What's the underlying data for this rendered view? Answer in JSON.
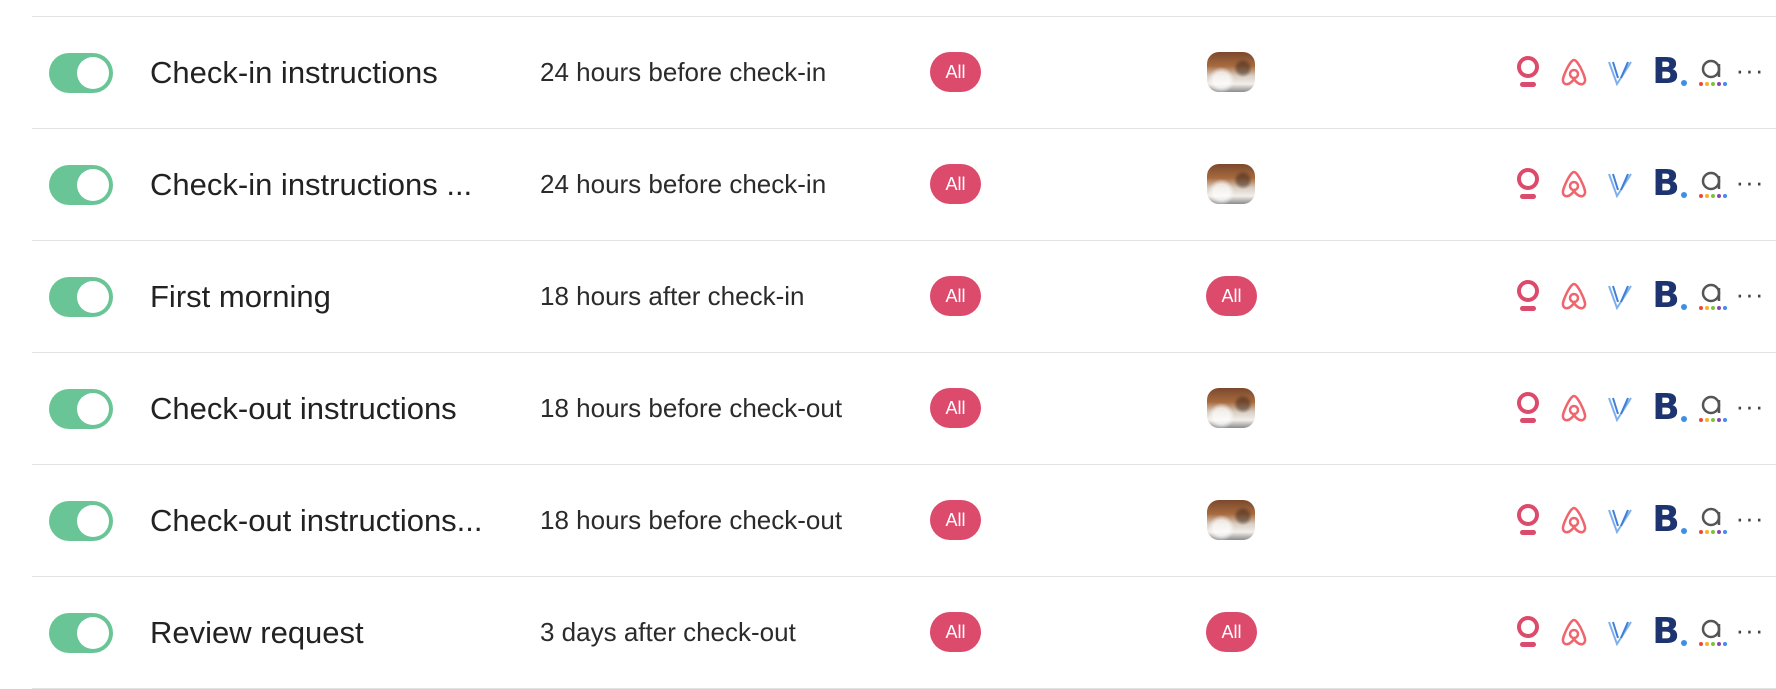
{
  "rows": [
    {
      "enabled": true,
      "title": "Check-in instructions",
      "timing": "24 hours before check-in",
      "audience": "All",
      "listing_type": "photo",
      "listing_label": ""
    },
    {
      "enabled": true,
      "title": "Check-in instructions ...",
      "timing": "24 hours before check-in",
      "audience": "All",
      "listing_type": "photo",
      "listing_label": ""
    },
    {
      "enabled": true,
      "title": "First morning",
      "timing": "18 hours after check-in",
      "audience": "All",
      "listing_type": "pill",
      "listing_label": "All"
    },
    {
      "enabled": true,
      "title": "Check-out instructions",
      "timing": "18 hours before check-out",
      "audience": "All",
      "listing_type": "photo",
      "listing_label": ""
    },
    {
      "enabled": true,
      "title": "Check-out instructions...",
      "timing": "18 hours before check-out",
      "audience": "All",
      "listing_type": "photo",
      "listing_label": ""
    },
    {
      "enabled": true,
      "title": "Review request",
      "timing": "3 days after check-out",
      "audience": "All",
      "listing_type": "pill",
      "listing_label": "All"
    }
  ],
  "channels": [
    {
      "name": "direct-booking-icon",
      "color": "#dc4a6c"
    },
    {
      "name": "airbnb-icon",
      "color": "#f0646e"
    },
    {
      "name": "vrbo-icon",
      "color": "#3f7fd8"
    },
    {
      "name": "booking-com-icon",
      "color": "#1e3470"
    },
    {
      "name": "agoda-icon",
      "color": "#555555"
    }
  ],
  "more_label": "···"
}
